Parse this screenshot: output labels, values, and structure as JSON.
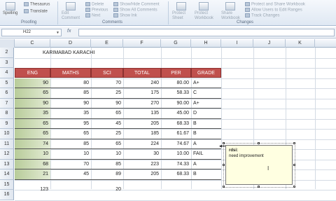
{
  "ribbon": {
    "proofing_group": "Proofing",
    "comments_group": "Comments",
    "changes_group": "Changes",
    "spelling": "Spelling",
    "thesaurus": "Thesaurus",
    "translate": "Translate",
    "new_comment": "Edit Comment",
    "delete": "Delete",
    "previous": "Previous",
    "next": "Next",
    "show_hide_comment": "Show/Hide Comment",
    "show_all_comments": "Show All Comments",
    "show_ink": "Show Ink",
    "protect_sheet": "Protect Sheet",
    "protect_workbook": "Protect Workbook",
    "share_workbook": "Share Workbook",
    "protect_and_share": "Protect and Share Workbook",
    "allow_users": "Allow Users to Edit Ranges",
    "track_changes": "Track Changes"
  },
  "formula_bar": {
    "name_box": "H22",
    "fx": "fx",
    "formula": ""
  },
  "columns": [
    "C",
    "D",
    "E",
    "F",
    "G",
    "H",
    "I",
    "J",
    "K"
  ],
  "rows": [
    "2",
    "3",
    "4",
    "5",
    "6",
    "7",
    "8",
    "9",
    "10",
    "11",
    "12",
    "13",
    "14",
    "15",
    "16"
  ],
  "sheet": {
    "title": "KARIMABAD KARACHI",
    "headers": [
      "ENG",
      "MATHS",
      "SCI",
      "TOTAL",
      "PER",
      "GRADE"
    ],
    "data": [
      [
        "90",
        "80",
        "70",
        "240",
        "80.00",
        "A+"
      ],
      [
        "65",
        "85",
        "25",
        "175",
        "58.33",
        "C"
      ],
      [
        "90",
        "90",
        "90",
        "270",
        "90.00",
        "A+"
      ],
      [
        "35",
        "35",
        "65",
        "135",
        "45.00",
        "D"
      ],
      [
        "65",
        "95",
        "45",
        "205",
        "68.33",
        "B"
      ],
      [
        "65",
        "65",
        "25",
        "185",
        "61.67",
        "B"
      ],
      [
        "74",
        "85",
        "65",
        "224",
        "74.67",
        "A"
      ],
      [
        "10",
        "10",
        "10",
        "30",
        "10.00",
        "FAIL"
      ],
      [
        "68",
        "70",
        "85",
        "223",
        "74.33",
        "A"
      ],
      [
        "21",
        "45",
        "89",
        "205",
        "68.33",
        "B"
      ]
    ],
    "row16": [
      "123",
      "",
      "20"
    ]
  },
  "comment": {
    "author": "rdsi:",
    "text": "need improvement"
  },
  "colors": {
    "header_fill": "#c0504d",
    "green_fill": "#b8cc9a",
    "comment_fill": "#ffffe1"
  }
}
